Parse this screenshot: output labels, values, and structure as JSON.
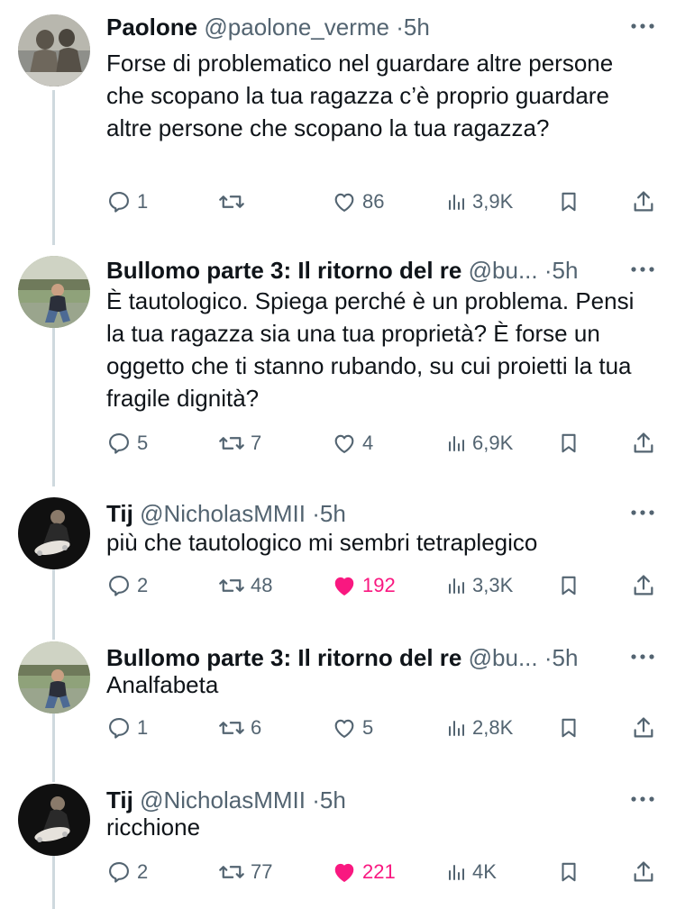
{
  "tweets": [
    {
      "name": "Paolone",
      "handle": "@paolone_verme",
      "time": "5h",
      "text": "Forse di problematico nel guardare altre persone che scopano la tua ragazza c’è proprio guardare altre persone che scopano la tua ragazza?",
      "replies": "1",
      "retweets": "",
      "likes": "86",
      "views": "3,9K",
      "liked": false
    },
    {
      "name": "Bullomo parte 3: Il ritorno del re",
      "handle": "@bu...",
      "time": "5h",
      "text": "È tautologico. Spiega perché è un problema. Pensi la tua ragazza sia una tua proprietà? È forse un oggetto che ti stanno rubando, su cui proietti la tua fragile dignità?",
      "replies": "5",
      "retweets": "7",
      "likes": "4",
      "views": "6,9K",
      "liked": false
    },
    {
      "name": "Tij",
      "handle": "@NicholasMMII",
      "time": "5h",
      "text": "più che tautologico mi sembri tetraplegico",
      "replies": "2",
      "retweets": "48",
      "likes": "192",
      "views": "3,3K",
      "liked": true
    },
    {
      "name": "Bullomo parte 3: Il ritorno del re",
      "handle": "@bu...",
      "time": "5h",
      "text": "Analfabeta",
      "replies": "1",
      "retweets": "6",
      "likes": "5",
      "views": "2,8K",
      "liked": false
    },
    {
      "name": "Tij",
      "handle": "@NicholasMMII",
      "time": "5h",
      "text": "ricchione",
      "replies": "2",
      "retweets": "77",
      "likes": "221",
      "views": "4K",
      "liked": true
    }
  ],
  "separator": "·",
  "colors": {
    "like_active": "#f91880",
    "secondary": "#536471",
    "thread_line": "#cfd9de"
  },
  "icons": [
    "reply-icon",
    "retweet-icon",
    "heart-icon",
    "views-icon",
    "bookmark-icon",
    "share-icon",
    "more-icon"
  ]
}
